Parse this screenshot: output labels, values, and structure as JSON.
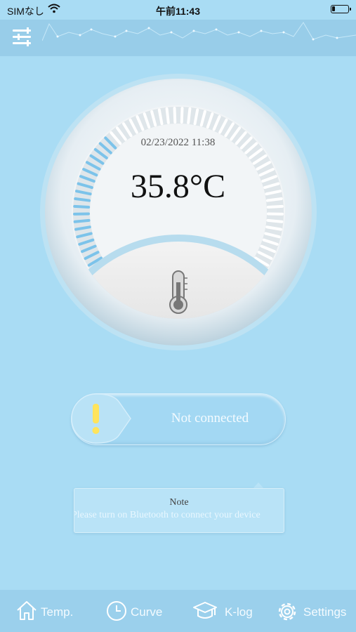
{
  "status_bar": {
    "carrier": "SIMなし",
    "time": "午前11:43",
    "battery_level": 0.2
  },
  "header": {
    "menu_icon": "menu-icon"
  },
  "gauge": {
    "timestamp": "02/23/2022 11:38",
    "temperature": "35.8°C",
    "active_tick_fraction": 0.33,
    "icon": "thermometer-icon"
  },
  "connection": {
    "status": "Not connected",
    "icon": "exclamation-icon"
  },
  "note": {
    "title": "Note",
    "text": "Please turn on Bluetooth to connect your device"
  },
  "tabs": [
    {
      "label": "Temp.",
      "icon": "home-icon"
    },
    {
      "label": "Curve",
      "icon": "clock-icon"
    },
    {
      "label": "K-log",
      "icon": "graduation-cap-icon"
    },
    {
      "label": "Settings",
      "icon": "gear-icon"
    }
  ],
  "colors": {
    "background": "#a9dcf4",
    "header": "#98cde9",
    "active_tick": "#7cc3ea",
    "inactive_tick": "#ffffff",
    "exclamation": "#ffe45c"
  }
}
